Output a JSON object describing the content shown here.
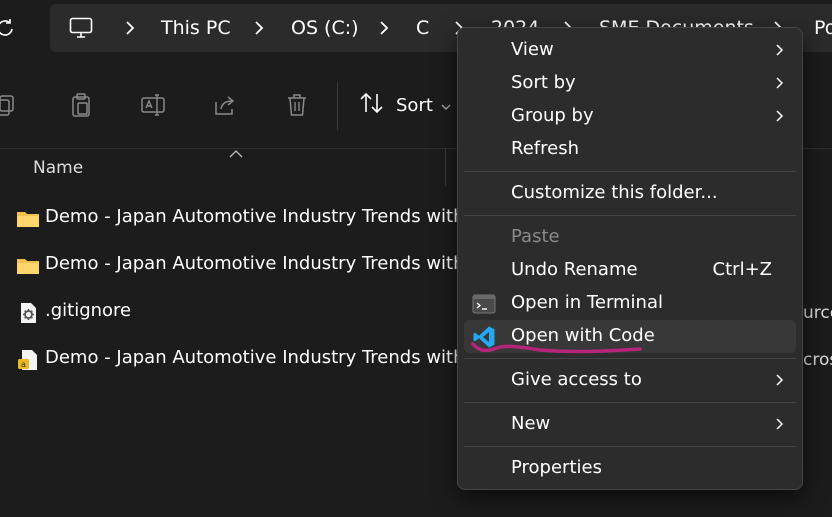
{
  "breadcrumbs": [
    "This PC",
    "OS (C:)",
    "C",
    "2024",
    "SME Documents",
    "Po"
  ],
  "toolbar": {
    "sort_label": "Sort"
  },
  "list": {
    "column_name": "Name",
    "rows": [
      {
        "name": "Demo - Japan Automotive Industry Trends with...",
        "icon": "folder-icon"
      },
      {
        "name": "Demo - Japan Automotive Industry Trends with...",
        "icon": "folder-icon"
      },
      {
        "name": ".gitignore",
        "icon": "settings-file-icon"
      },
      {
        "name": "Demo - Japan Automotive Industry Trends with...",
        "icon": "document-file-icon"
      }
    ],
    "right_column_fragments": [
      "urce",
      "cros"
    ]
  },
  "context_menu": {
    "items": [
      {
        "label": "View",
        "submenu": true
      },
      {
        "label": "Sort by",
        "submenu": true
      },
      {
        "label": "Group by",
        "submenu": true
      },
      {
        "label": "Refresh"
      },
      {
        "label": "Customize this folder..."
      },
      {
        "label": "Paste",
        "disabled": true
      },
      {
        "label": "Undo Rename",
        "shortcut": "Ctrl+Z"
      },
      {
        "label": "Open in Terminal",
        "icon": "terminal-icon"
      },
      {
        "label": "Open with Code",
        "icon": "vscode-icon",
        "highlighted": true
      },
      {
        "label": "Give access to",
        "submenu": true
      },
      {
        "label": "New",
        "submenu": true
      },
      {
        "label": "Properties"
      }
    ]
  },
  "colors": {
    "background": "#1c1c1c",
    "menu_background": "#2c2c2c",
    "folder": "#f2c14e",
    "vscode": "#23a9f2",
    "annotation": "#b5257a"
  }
}
